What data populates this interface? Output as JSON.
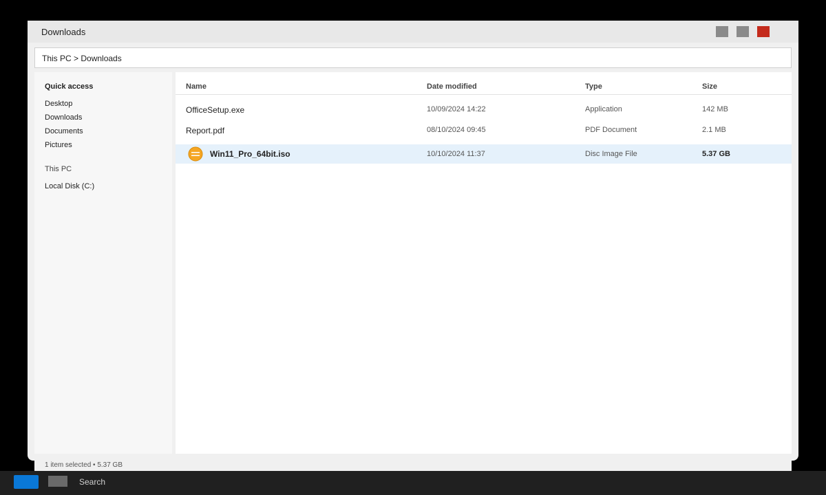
{
  "window": {
    "title": "Downloads",
    "controls": {
      "minimize_color": "#8a8a8a",
      "maximize_color": "#8a8a8a",
      "close_color": "#c42b1c"
    }
  },
  "address_bar": {
    "path": "This PC > Downloads"
  },
  "sidebar": {
    "quick_access_label": "Quick access",
    "quick_access_items": [
      {
        "label": "Desktop"
      },
      {
        "label": "Downloads"
      },
      {
        "label": "Documents"
      },
      {
        "label": "Pictures"
      }
    ],
    "this_pc_label": "This PC",
    "drives": [
      {
        "label": "Local Disk (C:)"
      }
    ]
  },
  "file_list": {
    "columns": {
      "name": "Name",
      "date_modified": "Date modified",
      "type": "Type",
      "size": "Size"
    },
    "rows": [
      {
        "name": "OfficeSetup.exe",
        "date_modified": "10/09/2024 14:22",
        "type": "Application",
        "size": "142 MB",
        "selected": false
      },
      {
        "name": "Report.pdf",
        "date_modified": "08/10/2024 09:45",
        "type": "PDF Document",
        "size": "2.1 MB",
        "selected": false
      },
      {
        "name": "Win11_Pro_64bit.iso",
        "date_modified": "10/10/2024 11:37",
        "type": "Disc Image File",
        "size": "5.37 GB",
        "selected": true,
        "icon": "disc-image-icon"
      }
    ]
  },
  "status_bar": {
    "text": "1 item selected • 5.37 GB"
  },
  "taskbar": {
    "search_label": "Search",
    "start_color": "#0a78d7"
  },
  "colors": {
    "selection": "#e5f1fb",
    "iso_icon": "#f5a623"
  }
}
